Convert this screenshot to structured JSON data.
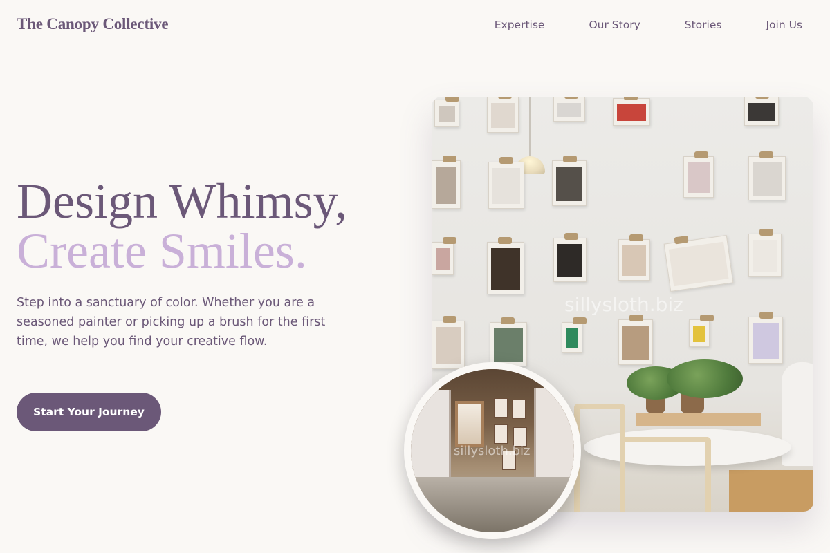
{
  "header": {
    "brand": "The Canopy Collective",
    "nav": [
      {
        "label": "Expertise"
      },
      {
        "label": "Our Story"
      },
      {
        "label": "Stories"
      },
      {
        "label": "Join Us"
      }
    ]
  },
  "hero": {
    "headline_line1": "Design Whimsy,",
    "headline_line2": "Create Smiles.",
    "description": "Step into a sanctuary of color. Whether you are a seasoned painter or picking up a brush for the first time, we help you find your creative flow.",
    "cta_label": "Start Your Journey"
  },
  "images": {
    "main_watermark": "sillysloth.biz",
    "inset_watermark": "sillysloth.biz"
  },
  "colors": {
    "primary": "#6b5878",
    "accent_lilac": "#c9b0d8",
    "background": "#faf8f5"
  }
}
